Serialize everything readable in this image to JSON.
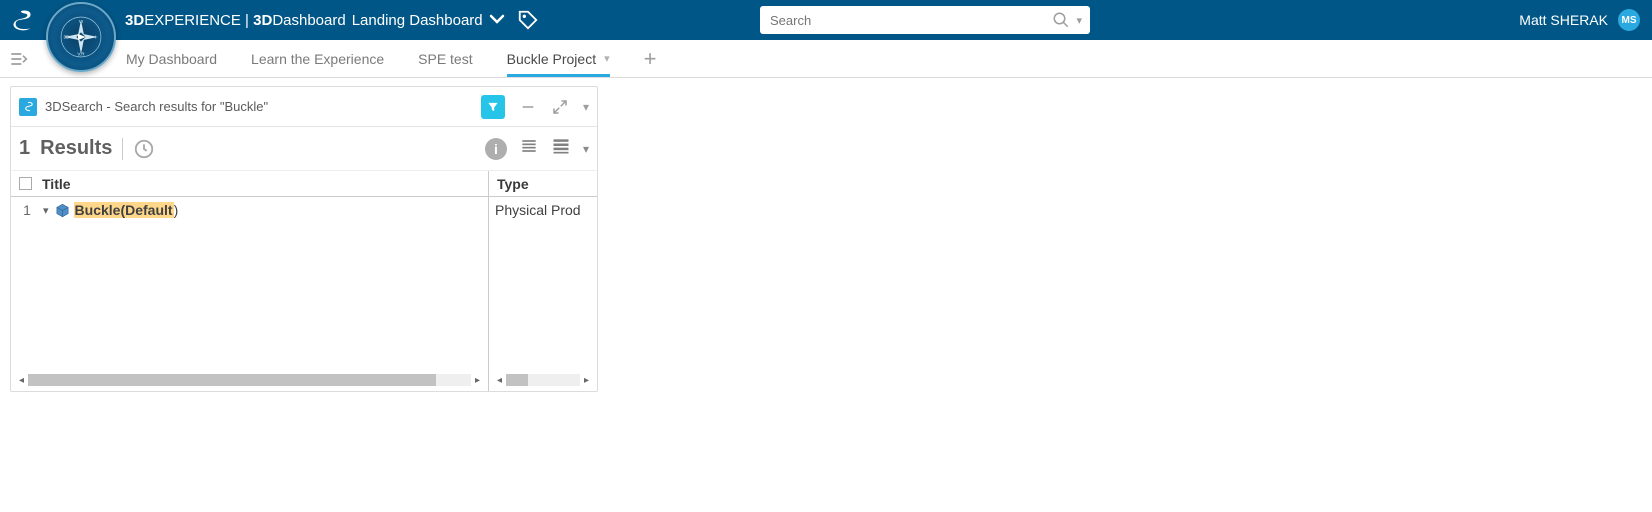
{
  "top": {
    "brand_prefix": "3D",
    "brand_rest": "EXPERIENCE",
    "divider": " | ",
    "app_bold": "3D",
    "app_rest": "Dashboard",
    "crumb": "Landing Dashboard",
    "search_placeholder": "Search",
    "user_name": "Matt SHERAK",
    "avatar_initials": "MS"
  },
  "tabs": {
    "items": [
      {
        "label": "My Dashboard"
      },
      {
        "label": "Learn the Experience"
      },
      {
        "label": "SPE test"
      },
      {
        "label": "Buckle Project",
        "active": true,
        "has_caret": true
      }
    ]
  },
  "widget": {
    "title": "3DSearch - Search results for \"Buckle\""
  },
  "results": {
    "count": "1",
    "label": "Results"
  },
  "table": {
    "headers": {
      "title": "Title",
      "type": "Type"
    },
    "rows": [
      {
        "num": "1",
        "title_hl": "Buckle(Default",
        "title_suffix": ")",
        "type": "Physical Prod"
      }
    ]
  }
}
